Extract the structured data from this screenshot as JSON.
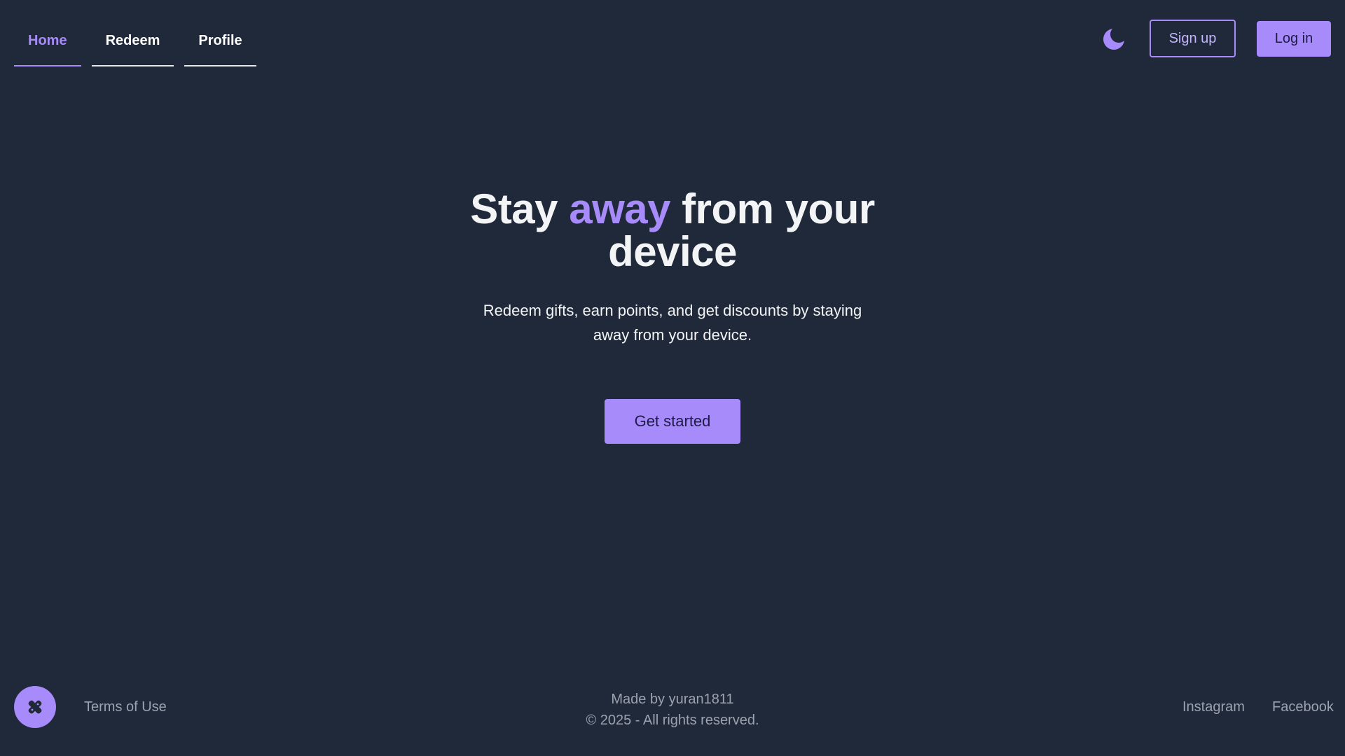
{
  "nav": {
    "tabs": [
      {
        "label": "Home",
        "active": true
      },
      {
        "label": "Redeem",
        "active": false
      },
      {
        "label": "Profile",
        "active": false
      }
    ]
  },
  "header": {
    "theme_icon": "moon-icon",
    "signup_label": "Sign up",
    "login_label": "Log in"
  },
  "hero": {
    "title_part1": "Stay ",
    "title_accent": "away",
    "title_part2": " from your device",
    "subtitle": "Redeem gifts, earn points, and get discounts by staying away from your device.",
    "cta_label": "Get started"
  },
  "footer": {
    "logo_icon": "logo-icon",
    "terms_label": "Terms of Use",
    "made_by": "Made by yuran1811",
    "copyright": "© 2025 - All rights reserved.",
    "instagram_label": "Instagram",
    "facebook_label": "Facebook"
  },
  "colors": {
    "background": "#202939",
    "accent": "#a78bfa",
    "text": "#f3f4f6",
    "muted": "#9ca3af"
  }
}
